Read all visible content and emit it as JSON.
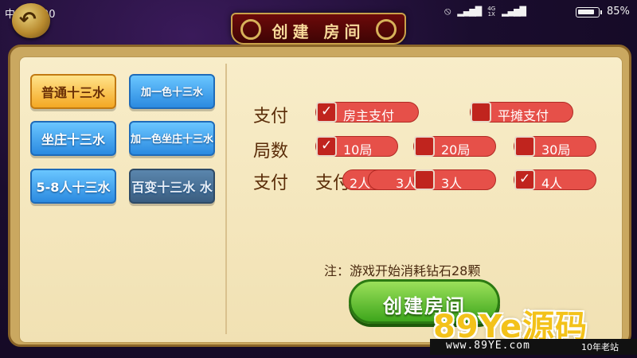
{
  "status_bar": {
    "time": "中午12:00",
    "battery": "85%",
    "battery_level": 0.85,
    "icons": [
      "alarm-muted-icon",
      "signal-icon",
      "network-4g-icon",
      "signal-icon"
    ]
  },
  "header": {
    "title": "创建 房间"
  },
  "modes": [
    {
      "label": "普通十三水",
      "selected": true
    },
    {
      "label": "加一色十三水",
      "selected": false
    },
    {
      "label": "坐庄十三水",
      "selected": false
    },
    {
      "label": "加一色坐庄十三水",
      "selected": false
    },
    {
      "label": "5-8人十三水",
      "selected": false
    },
    {
      "label": "百变十三水 水",
      "selected": false
    }
  ],
  "rows": {
    "pay_label": "支付",
    "rounds_label": "局数",
    "players_label": "支付",
    "players_sub_label": "支付"
  },
  "options": {
    "host_pay": {
      "label": "房主支付",
      "checked": true
    },
    "split_pay": {
      "label": "平摊支付",
      "checked": false
    },
    "rounds_10": {
      "label": "10局",
      "checked": true
    },
    "rounds_20": {
      "label": "20局",
      "checked": false
    },
    "rounds_30": {
      "label": "30局",
      "checked": false
    },
    "players_2": {
      "label": "2人",
      "checked": false
    },
    "players_3a": {
      "label": "3人",
      "checked": false
    },
    "players_3b": {
      "label": "3人",
      "checked": false
    },
    "players_4": {
      "label": "4人",
      "checked": true
    }
  },
  "note": "注：游戏开始消耗钻石28颗",
  "create_button": "创建房间",
  "watermark": {
    "main": "89Ye源码",
    "url": "www.89YE.com",
    "tag": "10年老站"
  },
  "colors": {
    "option_red": "#e65049",
    "create_green": "#3ea61c",
    "selected_gold": "#f4a823",
    "mode_blue": "#2b8ae0"
  }
}
